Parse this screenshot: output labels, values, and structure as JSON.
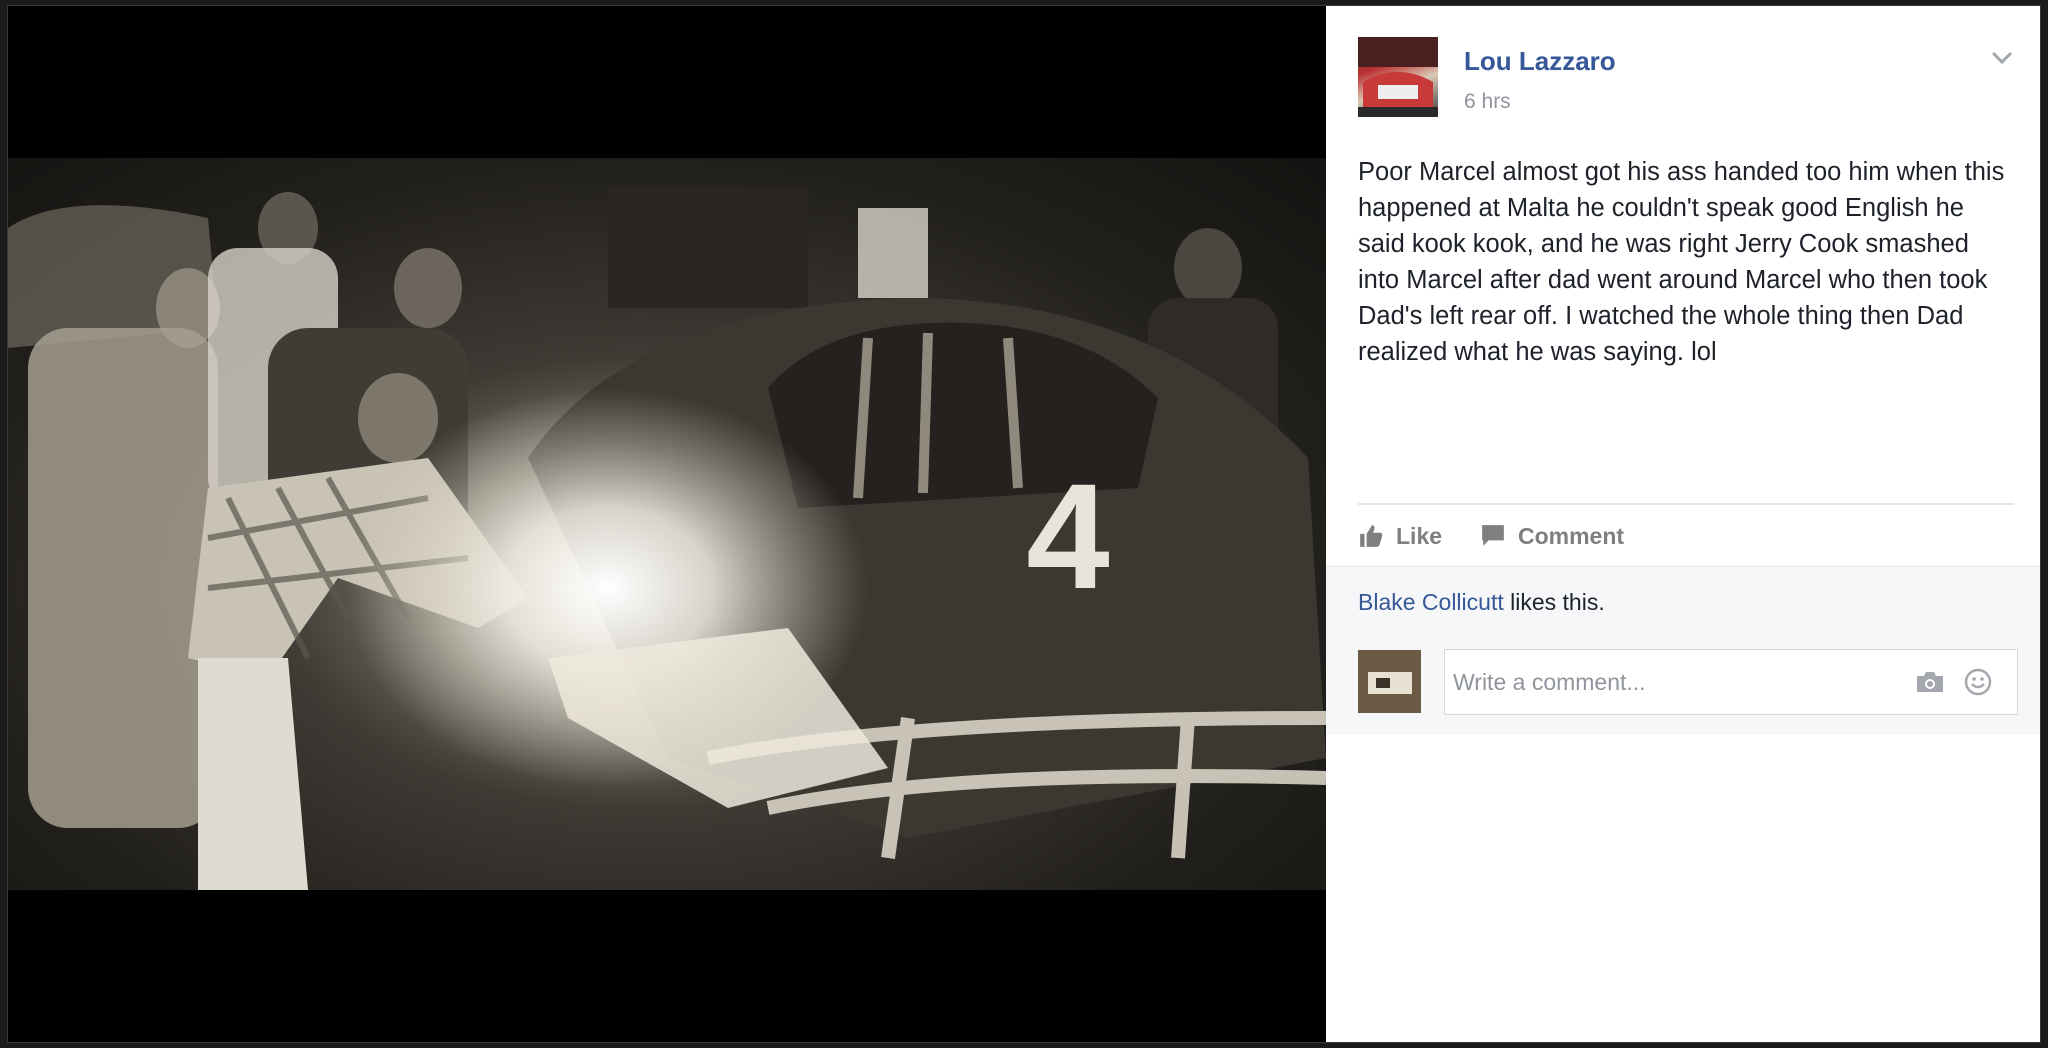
{
  "post": {
    "author": "Lou Lazzaro",
    "timestamp": "6 hrs",
    "text": "Poor Marcel almost got his ass handed too him when this happened at Malta he couldn't speak good English he said kook kook, and he was right Jerry Cook smashed into Marcel after dad went around Marcel who then took Dad's left rear off. I watched the whole thing then Dad realized what he was saying. lol"
  },
  "actions": {
    "like_label": "Like",
    "comment_label": "Comment"
  },
  "likes": {
    "liker_name": "Blake Collicutt",
    "suffix": " likes this."
  },
  "comment_box": {
    "placeholder": "Write a comment..."
  },
  "photo": {
    "car_number": "4"
  },
  "icons": {
    "chevron": "chevron-down-icon",
    "like": "thumbs-up-icon",
    "comment": "speech-bubble-icon",
    "camera": "camera-icon",
    "emoji": "smiley-icon"
  },
  "colors": {
    "link_blue": "#365899",
    "muted_gray": "#90949c",
    "text_dark": "#1d2129"
  }
}
